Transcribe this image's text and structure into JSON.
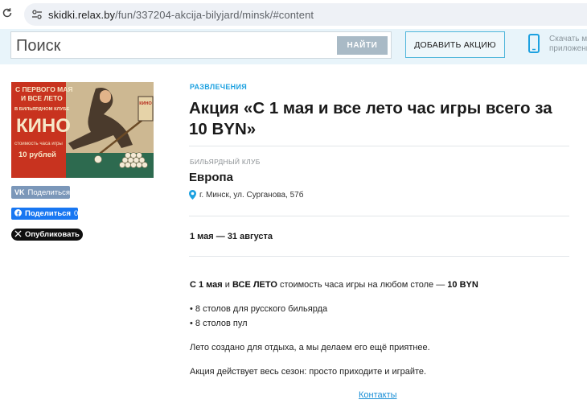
{
  "browser": {
    "url_host": "skidki.relax.by",
    "url_path": "/fun/337204-akcija-bilyjard/minsk/#content"
  },
  "header": {
    "search_placeholder": "Поиск",
    "search_button": "НАЙТИ",
    "add_promo_button": "ДОБАВИТЬ АКЦИЮ",
    "download_text_line1": "Скачать мо",
    "download_text_line2": "приложени"
  },
  "poster": {
    "line1": "С ПЕРВОГО МАЯ",
    "line2": "И ВСЕ ЛЕТО",
    "line3": "В БИЛЬЯРДНОМ КЛУБЕ",
    "club": "КИНО",
    "line5": "стоимость часа игры",
    "price": "10 рублей",
    "sign": "КИНО"
  },
  "share": {
    "vk_label": "Поделиться",
    "fb_label": "Поделиться",
    "fb_count": "0",
    "x_label": "Опубликовать"
  },
  "promo": {
    "category": "РАЗВЛЕЧЕНИЯ",
    "title": "Акция «С 1 мая и все лето час игры всего за 10 BYN»",
    "place_type": "БИЛЬЯРДНЫЙ КЛУБ",
    "place_name": "Европа",
    "address": "г. Минск, ул. Сурганова, 57б",
    "dates": "1 мая — 31 августа",
    "desc_bold1": "С 1 мая",
    "desc_and": " и ",
    "desc_bold2": "ВСЕ ЛЕТО",
    "desc_mid": " стоимость часа игры на любом столе — ",
    "desc_price": "10 BYN",
    "bullet1": "• 8 столов для русского бильярда",
    "bullet2": "• 8 столов пул",
    "paragraph1": "Лето создано для отдыха, а мы делаем его ещё приятнее.",
    "paragraph2": "Акция действует весь сезон: просто приходите и играйте.",
    "contacts_link": "Контакты"
  },
  "colors": {
    "accent": "#1da1e0",
    "header_bg": "#e8f4fa",
    "vk": "#7b97b9",
    "fb": "#1877f2"
  }
}
